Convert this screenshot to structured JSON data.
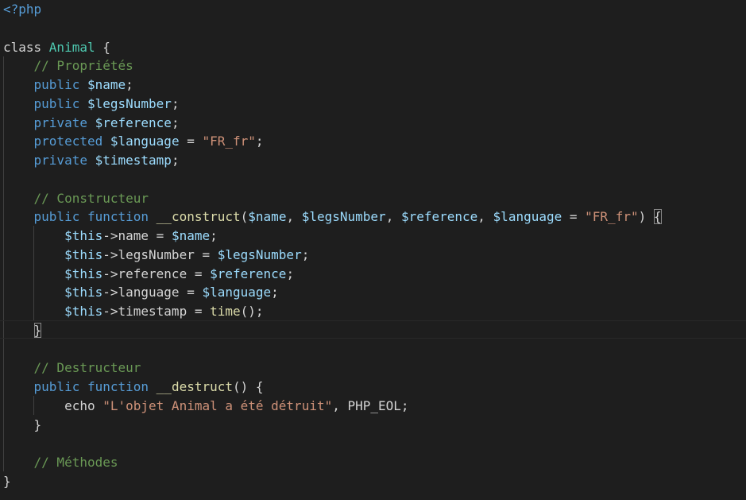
{
  "editor": {
    "language": "php",
    "lines": [
      [
        {
          "t": "<?php",
          "c": "keyword"
        }
      ],
      [],
      [
        {
          "t": "class ",
          "c": "plain"
        },
        {
          "t": "Animal",
          "c": "class"
        },
        {
          "t": " {",
          "c": "punct"
        }
      ],
      [
        {
          "t": "    ",
          "c": "plain"
        },
        {
          "t": "// Propriétés",
          "c": "comment"
        }
      ],
      [
        {
          "t": "    ",
          "c": "plain"
        },
        {
          "t": "public",
          "c": "keyword"
        },
        {
          "t": " ",
          "c": "plain"
        },
        {
          "t": "$name",
          "c": "var"
        },
        {
          "t": ";",
          "c": "punct"
        }
      ],
      [
        {
          "t": "    ",
          "c": "plain"
        },
        {
          "t": "public",
          "c": "keyword"
        },
        {
          "t": " ",
          "c": "plain"
        },
        {
          "t": "$legsNumber",
          "c": "var"
        },
        {
          "t": ";",
          "c": "punct"
        }
      ],
      [
        {
          "t": "    ",
          "c": "plain"
        },
        {
          "t": "private",
          "c": "keyword"
        },
        {
          "t": " ",
          "c": "plain"
        },
        {
          "t": "$reference",
          "c": "var"
        },
        {
          "t": ";",
          "c": "punct"
        }
      ],
      [
        {
          "t": "    ",
          "c": "plain"
        },
        {
          "t": "protected",
          "c": "keyword"
        },
        {
          "t": " ",
          "c": "plain"
        },
        {
          "t": "$language",
          "c": "var"
        },
        {
          "t": " = ",
          "c": "plain"
        },
        {
          "t": "\"FR_fr\"",
          "c": "string"
        },
        {
          "t": ";",
          "c": "punct"
        }
      ],
      [
        {
          "t": "    ",
          "c": "plain"
        },
        {
          "t": "private",
          "c": "keyword"
        },
        {
          "t": " ",
          "c": "plain"
        },
        {
          "t": "$timestamp",
          "c": "var"
        },
        {
          "t": ";",
          "c": "punct"
        }
      ],
      [],
      [
        {
          "t": "    ",
          "c": "plain"
        },
        {
          "t": "// Constructeur",
          "c": "comment"
        }
      ],
      [
        {
          "t": "    ",
          "c": "plain"
        },
        {
          "t": "public",
          "c": "keyword"
        },
        {
          "t": " ",
          "c": "plain"
        },
        {
          "t": "function",
          "c": "keyword"
        },
        {
          "t": " ",
          "c": "plain"
        },
        {
          "t": "__construct",
          "c": "func"
        },
        {
          "t": "(",
          "c": "punct"
        },
        {
          "t": "$name",
          "c": "var"
        },
        {
          "t": ", ",
          "c": "punct"
        },
        {
          "t": "$legsNumber",
          "c": "var"
        },
        {
          "t": ", ",
          "c": "punct"
        },
        {
          "t": "$reference",
          "c": "var"
        },
        {
          "t": ", ",
          "c": "punct"
        },
        {
          "t": "$language",
          "c": "var"
        },
        {
          "t": " = ",
          "c": "plain"
        },
        {
          "t": "\"FR_fr\"",
          "c": "string"
        },
        {
          "t": ") ",
          "c": "punct"
        },
        {
          "t": "{",
          "c": "punct",
          "b": true
        }
      ],
      [
        {
          "t": "        ",
          "c": "plain"
        },
        {
          "t": "$this",
          "c": "var"
        },
        {
          "t": "->",
          "c": "punct"
        },
        {
          "t": "name",
          "c": "ident"
        },
        {
          "t": " = ",
          "c": "plain"
        },
        {
          "t": "$name",
          "c": "var"
        },
        {
          "t": ";",
          "c": "punct"
        }
      ],
      [
        {
          "t": "        ",
          "c": "plain"
        },
        {
          "t": "$this",
          "c": "var"
        },
        {
          "t": "->",
          "c": "punct"
        },
        {
          "t": "legsNumber",
          "c": "ident"
        },
        {
          "t": " = ",
          "c": "plain"
        },
        {
          "t": "$legsNumber",
          "c": "var"
        },
        {
          "t": ";",
          "c": "punct"
        }
      ],
      [
        {
          "t": "        ",
          "c": "plain"
        },
        {
          "t": "$this",
          "c": "var"
        },
        {
          "t": "->",
          "c": "punct"
        },
        {
          "t": "reference",
          "c": "ident"
        },
        {
          "t": " = ",
          "c": "plain"
        },
        {
          "t": "$reference",
          "c": "var"
        },
        {
          "t": ";",
          "c": "punct"
        }
      ],
      [
        {
          "t": "        ",
          "c": "plain"
        },
        {
          "t": "$this",
          "c": "var"
        },
        {
          "t": "->",
          "c": "punct"
        },
        {
          "t": "language",
          "c": "ident"
        },
        {
          "t": " = ",
          "c": "plain"
        },
        {
          "t": "$language",
          "c": "var"
        },
        {
          "t": ";",
          "c": "punct"
        }
      ],
      [
        {
          "t": "        ",
          "c": "plain"
        },
        {
          "t": "$this",
          "c": "var"
        },
        {
          "t": "->",
          "c": "punct"
        },
        {
          "t": "timestamp",
          "c": "ident"
        },
        {
          "t": " = ",
          "c": "plain"
        },
        {
          "t": "time",
          "c": "func"
        },
        {
          "t": "();",
          "c": "punct"
        }
      ],
      [
        {
          "t": "    ",
          "c": "plain"
        },
        {
          "t": "}",
          "c": "punct",
          "b": true
        }
      ],
      [],
      [
        {
          "t": "    ",
          "c": "plain"
        },
        {
          "t": "// Destructeur",
          "c": "comment"
        }
      ],
      [
        {
          "t": "    ",
          "c": "plain"
        },
        {
          "t": "public",
          "c": "keyword"
        },
        {
          "t": " ",
          "c": "plain"
        },
        {
          "t": "function",
          "c": "keyword"
        },
        {
          "t": " ",
          "c": "plain"
        },
        {
          "t": "__destruct",
          "c": "func"
        },
        {
          "t": "() {",
          "c": "punct"
        }
      ],
      [
        {
          "t": "        ",
          "c": "plain"
        },
        {
          "t": "echo",
          "c": "ident"
        },
        {
          "t": " ",
          "c": "plain"
        },
        {
          "t": "\"L'objet Animal a été détruit\"",
          "c": "string"
        },
        {
          "t": ", ",
          "c": "punct"
        },
        {
          "t": "PHP_EOL",
          "c": "ident"
        },
        {
          "t": ";",
          "c": "punct"
        }
      ],
      [
        {
          "t": "    ",
          "c": "plain"
        },
        {
          "t": "}",
          "c": "punct"
        }
      ],
      [],
      [
        {
          "t": "    ",
          "c": "plain"
        },
        {
          "t": "// Méthodes",
          "c": "comment"
        }
      ],
      [
        {
          "t": "}",
          "c": "punct"
        }
      ]
    ]
  },
  "colors": {
    "background": "#1e1e1e",
    "keyword": "#569cd6",
    "variable": "#9cdcfe",
    "string": "#ce9178",
    "comment": "#6a9955",
    "class": "#4ec9b0",
    "function": "#dcdcaa",
    "default": "#d4d4d4"
  }
}
